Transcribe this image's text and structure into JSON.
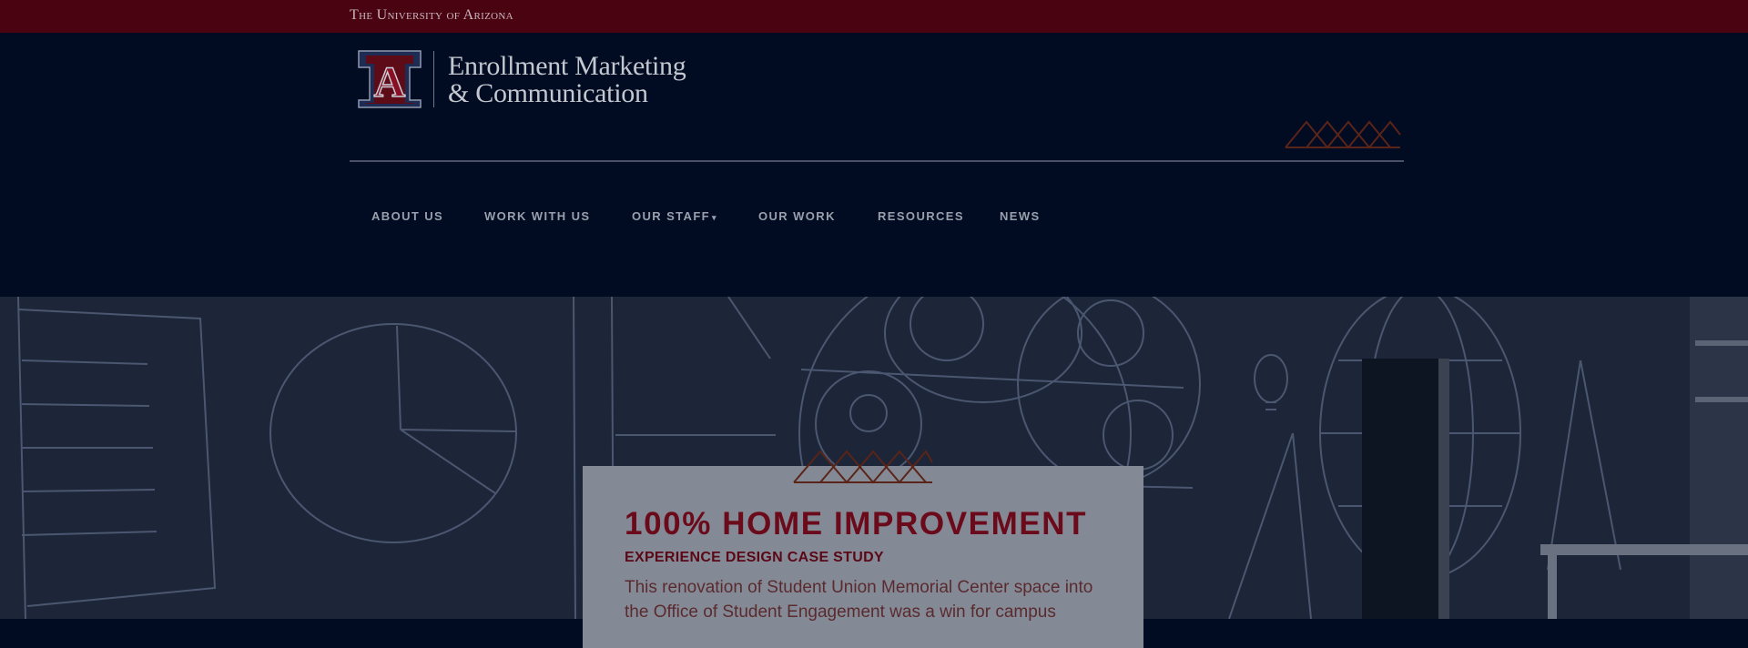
{
  "top_bar": {
    "university_name": "The University of Arizona"
  },
  "header": {
    "logo_letter": "A",
    "logo_title_line1": "Enrollment Marketing",
    "logo_title_line2": "& Communication"
  },
  "nav": {
    "items": [
      {
        "label": "ABOUT US"
      },
      {
        "label": "WORK WITH US"
      },
      {
        "label": "OUR STAFF"
      },
      {
        "label": "OUR WORK"
      },
      {
        "label": "RESOURCES"
      },
      {
        "label": "NEWS"
      }
    ],
    "dropdown_indicator": "▾"
  },
  "hero": {
    "card": {
      "title": "100% HOME IMPROVEMENT",
      "subtitle": "EXPERIENCE DESIGN CASE STUDY",
      "body": "This renovation of Student Union Memorial Center space into the Office of Student Engagement was a win for campus"
    }
  },
  "colors": {
    "top_bar": "#4a0310",
    "header_background": "#010b22",
    "card_title": "#6b0a1a",
    "accent_mark": "#5a2418"
  }
}
